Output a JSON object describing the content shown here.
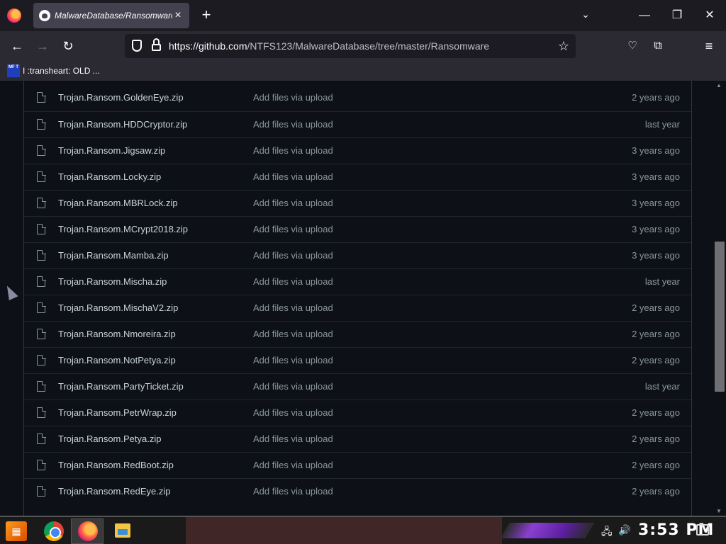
{
  "browser": {
    "tab_title": "MalwareDatabase/Ransomware",
    "tab_close": "×",
    "new_tab": "+",
    "url_host": "https://github.com",
    "url_path": "/NTFS123/MalwareDatabase/tree/master/Ransomware",
    "bookmark_label": "I :transheart: OLD ...",
    "bookmark_favicon": "MF T"
  },
  "files": [
    {
      "name": "Trojan.Ransom.GoldenEye.zip",
      "message": "Add files via upload",
      "age": "2 years ago"
    },
    {
      "name": "Trojan.Ransom.HDDCryptor.zip",
      "message": "Add files via upload",
      "age": "last year"
    },
    {
      "name": "Trojan.Ransom.Jigsaw.zip",
      "message": "Add files via upload",
      "age": "3 years ago"
    },
    {
      "name": "Trojan.Ransom.Locky.zip",
      "message": "Add files via upload",
      "age": "3 years ago"
    },
    {
      "name": "Trojan.Ransom.MBRLock.zip",
      "message": "Add files via upload",
      "age": "3 years ago"
    },
    {
      "name": "Trojan.Ransom.MCrypt2018.zip",
      "message": "Add files via upload",
      "age": "3 years ago"
    },
    {
      "name": "Trojan.Ransom.Mamba.zip",
      "message": "Add files via upload",
      "age": "3 years ago"
    },
    {
      "name": "Trojan.Ransom.Mischa.zip",
      "message": "Add files via upload",
      "age": "last year"
    },
    {
      "name": "Trojan.Ransom.MischaV2.zip",
      "message": "Add files via upload",
      "age": "2 years ago"
    },
    {
      "name": "Trojan.Ransom.Nmoreira.zip",
      "message": "Add files via upload",
      "age": "2 years ago"
    },
    {
      "name": "Trojan.Ransom.NotPetya.zip",
      "message": "Add files via upload",
      "age": "2 years ago"
    },
    {
      "name": "Trojan.Ransom.PartyTicket.zip",
      "message": "Add files via upload",
      "age": "last year"
    },
    {
      "name": "Trojan.Ransom.PetrWrap.zip",
      "message": "Add files via upload",
      "age": "2 years ago"
    },
    {
      "name": "Trojan.Ransom.Petya.zip",
      "message": "Add files via upload",
      "age": "2 years ago"
    },
    {
      "name": "Trojan.Ransom.RedBoot.zip",
      "message": "Add files via upload",
      "age": "2 years ago"
    },
    {
      "name": "Trojan.Ransom.RedEye.zip",
      "message": "Add files via upload",
      "age": "2 years ago"
    }
  ],
  "taskbar": {
    "clock": "3:53 PM"
  },
  "scroll": {
    "position_fraction": 0.37
  }
}
